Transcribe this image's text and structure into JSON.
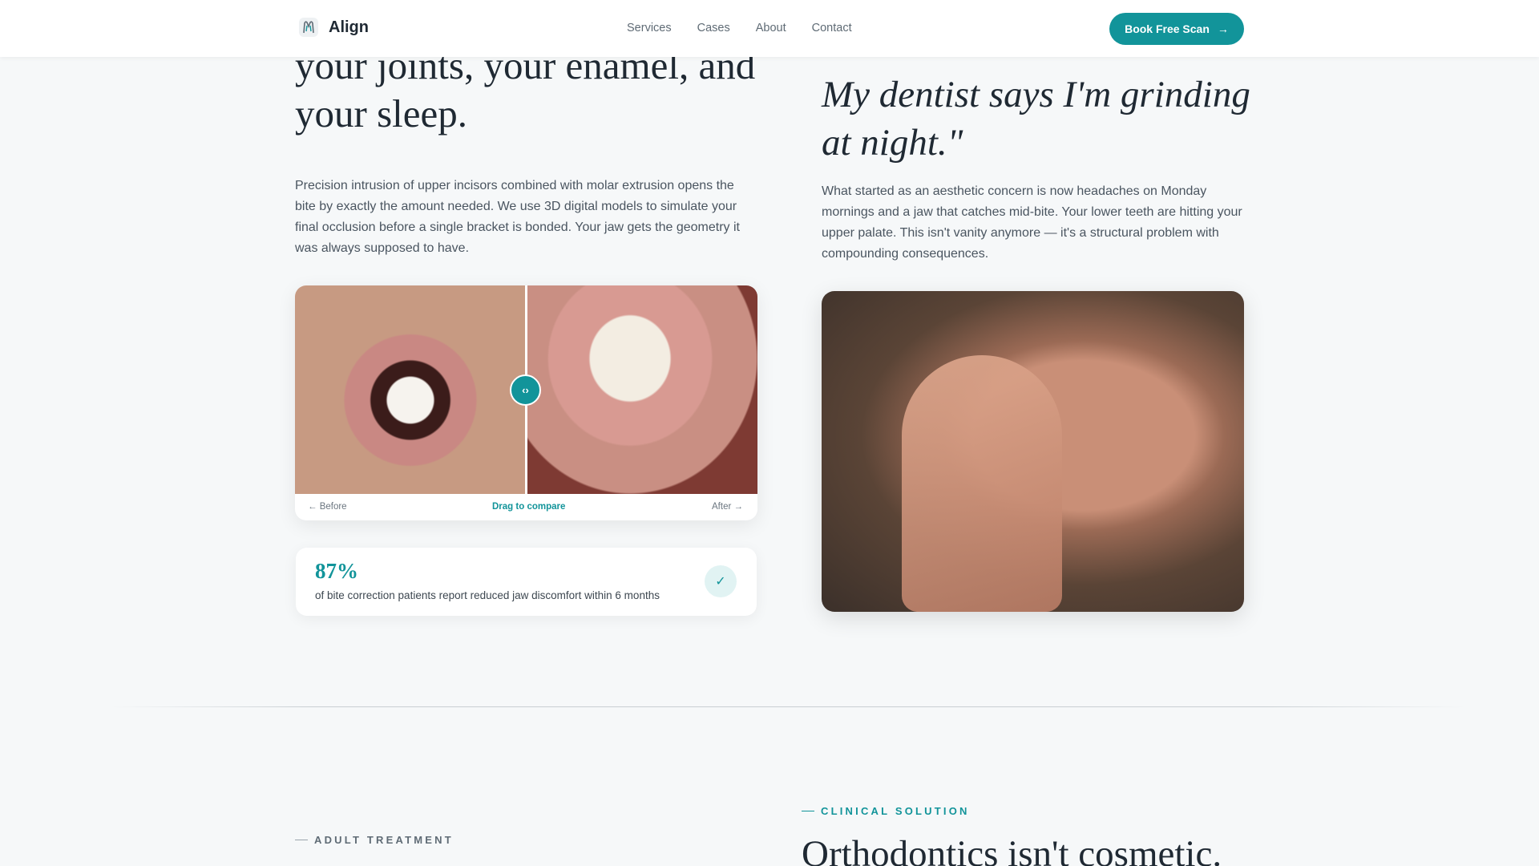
{
  "header": {
    "brand": "Align",
    "nav": [
      "Services",
      "Cases",
      "About",
      "Contact"
    ],
    "cta_label": "Book Free Scan"
  },
  "left": {
    "heading_lines": [
      "your joints, your enamel, and",
      "your sleep."
    ],
    "paragraph": "Precision intrusion of upper incisors combined with molar extrusion opens the bite by exactly the amount needed. We use 3D digital models to simulate your final occlusion before a single bracket is bonded. Your jaw gets the geometry it was always supposed to have.",
    "compare": {
      "before_label": "← Before",
      "drag_label": "Drag to compare",
      "after_label": "After →"
    },
    "stat": {
      "value": "87%",
      "text": "of bite correction patients report reduced jaw discomfort within 6 months"
    }
  },
  "right": {
    "quote_lines": [
      "My dentist says I'm grinding",
      "at night.\""
    ],
    "paragraph": "What started as an aesthetic concern is now headaches on Monday mornings and a jaw that catches mid-bite. Your lower teeth are hitting your upper palate. This isn't vanity anymore — it's a structural problem with compounding consequences."
  },
  "bottom": {
    "eyebrow_left": "ADULT TREATMENT",
    "eyebrow_right": "CLINICAL SOLUTION",
    "heading": "Orthodontics isn't cosmetic."
  },
  "colors": {
    "accent": "#12949a",
    "text": "#1f2933",
    "background": "#f6f8f9"
  }
}
